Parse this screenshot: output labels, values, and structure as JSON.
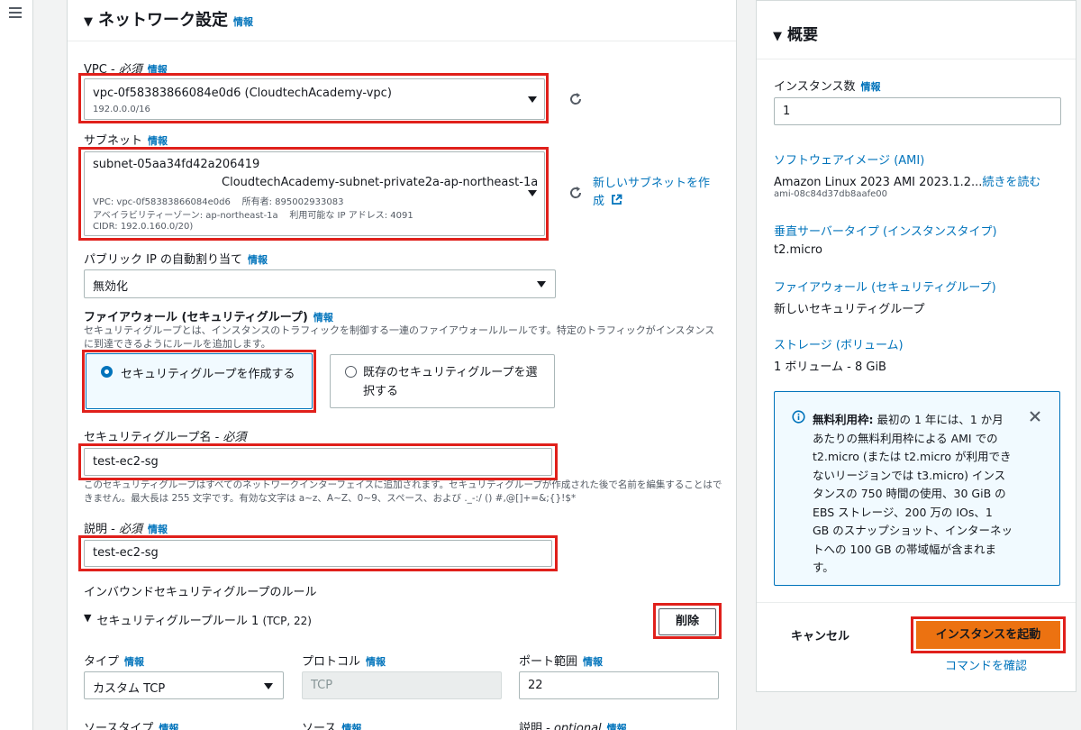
{
  "nav": {
    "menu_icon": "hamburger-icon"
  },
  "network": {
    "title": "ネットワーク設定",
    "info": "情報",
    "vpc": {
      "label": "VPC - ",
      "required": "必須",
      "info": "情報",
      "value": "vpc-0f58383866084e0d6 (CloudtechAcademy-vpc)",
      "cidr": "192.0.0.0/16"
    },
    "subnet": {
      "label": "サブネット",
      "info": "情報",
      "id": "subnet-05aa34fd42a206419",
      "name": "CloudtechAcademy-subnet-private2a-ap-northeast-1a",
      "vpc_line": "VPC: vpc-0f58383866084e0d6    所有者: 895002933083",
      "az_line": "アベイラビリティーゾーン: ap-northeast-1a    利用可能な IP アドレス: 4091",
      "cidr_line": "CIDR: 192.0.160.0/20)",
      "create_link": "新しいサブネットを作成"
    },
    "public_ip": {
      "label": "パブリック IP の自動割り当て",
      "info": "情報",
      "value": "無効化"
    },
    "firewall": {
      "label": "ファイアウォール (セキュリティグループ)",
      "info": "情報",
      "desc": "セキュリティグループとは、インスタンスのトラフィックを制御する一連のファイアウォールルールです。特定のトラフィックがインスタンスに到達できるようにルールを追加します。",
      "option_create": "セキュリティグループを作成する",
      "option_existing": "既存のセキュリティグループを選択する"
    },
    "sg_name": {
      "label": "セキュリティグループ名 - ",
      "required": "必須",
      "value": "test-ec2-sg",
      "desc": "このセキュリティグループはすべてのネットワークインターフェイスに追加されます。セキュリティグループが作成された後で名前を編集することはできません。最大長は 255 文字です。有効な文字は a~z、A~Z、0~9、スペース、および ._-:/ () #,@[]+=&;{}!$*"
    },
    "description": {
      "label": "説明 - ",
      "required": "必須",
      "info": "情報",
      "value": "test-ec2-sg"
    },
    "inbound": {
      "title": "インバウンドセキュリティグループのルール",
      "rule_title": "セキュリティグループルール 1",
      "rule_suffix": "(TCP, 22)",
      "delete": "削除",
      "type_label": "タイプ",
      "type_info": "情報",
      "type_value": "カスタム TCP",
      "protocol_label": "プロトコル",
      "protocol_info": "情報",
      "protocol_value": "TCP",
      "port_label": "ポート範囲",
      "port_info": "情報",
      "port_value": "22",
      "source_type_label": "ソースタイプ",
      "source_type_info": "情報",
      "source_label": "ソース",
      "source_info": "情報",
      "desc_label": "説明 - ",
      "desc_optional": "optional",
      "desc_info": "情報"
    }
  },
  "summary": {
    "title": "概要",
    "instances_label": "インスタンス数",
    "instances_info": "情報",
    "instances_value": "1",
    "ami_label": "ソフトウェアイメージ (AMI)",
    "ami_value": "Amazon Linux 2023 AMI 2023.1.2...",
    "ami_more": "続きを読む",
    "ami_id": "ami-08c84d37db8aafe00",
    "type_label": "垂直サーバータイプ (インスタンスタイプ)",
    "type_value": "t2.micro",
    "fw_label": "ファイアウォール (セキュリティグループ)",
    "fw_value": "新しいセキュリティグループ",
    "storage_label": "ストレージ (ボリューム)",
    "storage_value": "1 ボリューム - 8 GiB",
    "free_tier_title": "無料利用枠:",
    "free_tier_text": "最初の 1 年には、1 か月あたりの無料利用枠による AMI での t2.micro (または t2.micro が利用できないリージョンでは t3.micro) インスタンスの 750 時間の使用、30 GiB の EBS ストレージ、200 万の IOs、1 GB のスナップショット、インターネットへの 100 GB の帯域幅が含まれます。",
    "cancel": "キャンセル",
    "launch": "インスタンスを起動",
    "review": "コマンドを確認"
  },
  "colors": {
    "accent": "#0073bb",
    "highlight": "#e0201b",
    "primary": "#ec7211"
  }
}
